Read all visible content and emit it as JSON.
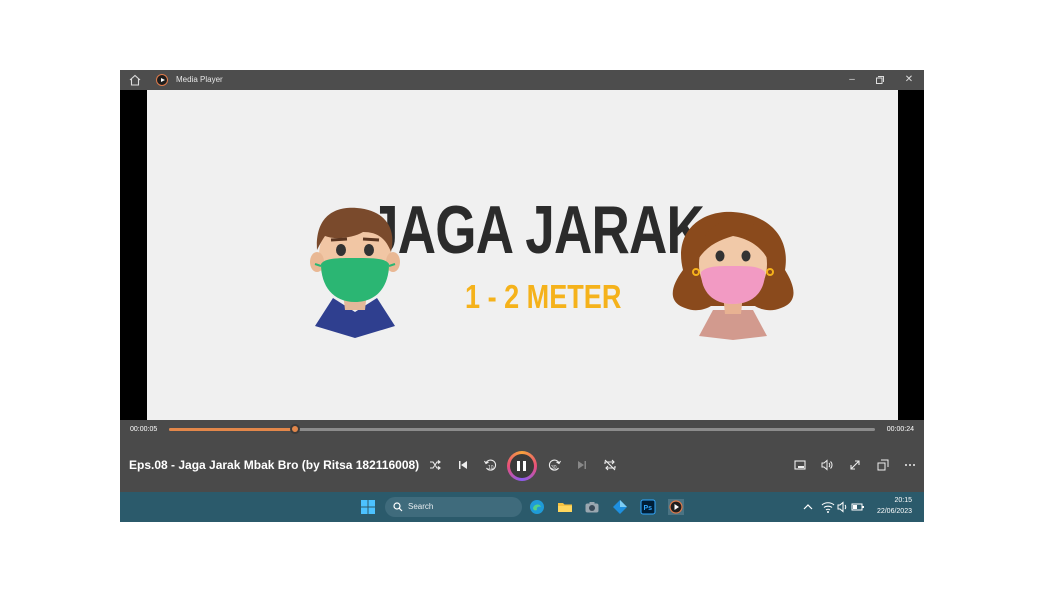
{
  "app": {
    "title": "Media Player"
  },
  "video": {
    "headline": "JAGA JARAK",
    "subline": "1 - 2 METER"
  },
  "playback": {
    "current_time": "00:00:05",
    "total_time": "00:00:24",
    "progress": 0.178,
    "media_title": "Eps.08 - Jaga Jarak Mbak Bro (by Ritsa 182116008)"
  },
  "taskbar": {
    "search_placeholder": "Search",
    "clock_time": "20:15",
    "clock_date": "22/06/2023"
  },
  "colors": {
    "accent": "#e3874a",
    "taskbar": "#2b5a6b",
    "controls_bg": "#4a4a4a",
    "subline": "#f5b21b"
  }
}
